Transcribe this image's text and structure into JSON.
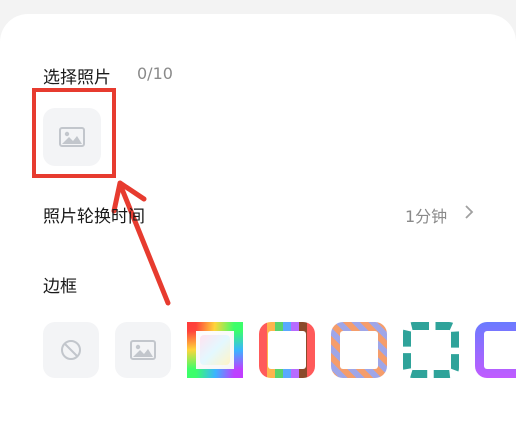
{
  "photo_section": {
    "title": "选择照片",
    "count": "0/10",
    "add_photo_icon": "image-icon"
  },
  "interval_row": {
    "label": "照片轮换时间",
    "value": "1分钟",
    "chevron_icon": "chevron-right-icon"
  },
  "frame_section": {
    "title": "边框",
    "options": [
      {
        "name": "none",
        "icon": "no-frame-icon"
      },
      {
        "name": "photo",
        "icon": "image-icon"
      },
      {
        "name": "rainbow-gradient"
      },
      {
        "name": "multicolor-stripes"
      },
      {
        "name": "diagonal-stripes"
      },
      {
        "name": "teal-dashed"
      },
      {
        "name": "purple-gradient"
      }
    ]
  },
  "annotation": {
    "highlight_color": "#e73b2f"
  }
}
